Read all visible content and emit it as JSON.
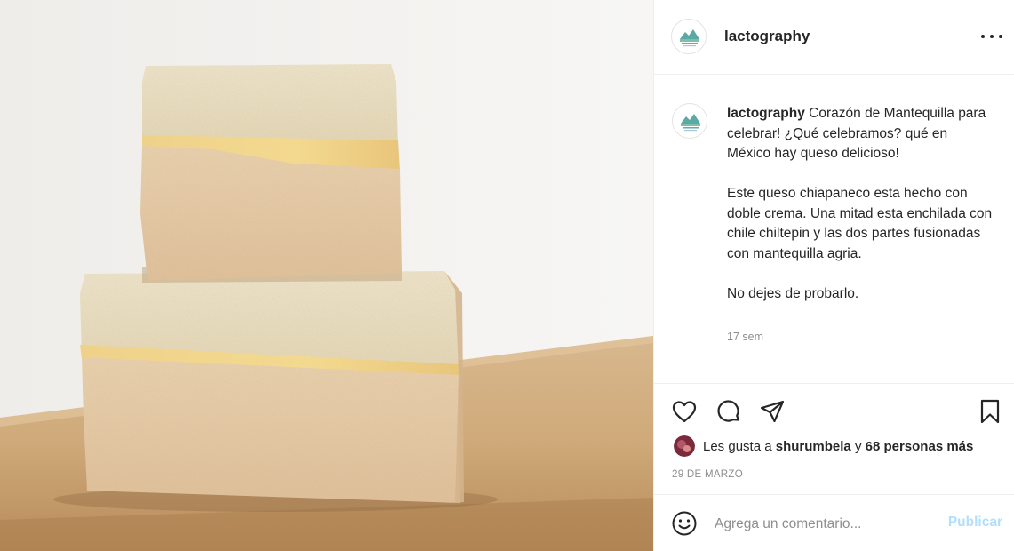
{
  "post": {
    "username": "lactography",
    "more_icon": "more-horizontal-icon",
    "caption": {
      "username": "lactography",
      "line1": "Corazón de Mantequilla para celebrar! ¿Qué celebramos? qué en México hay queso delicioso!",
      "line2": "Este queso chiapaneco esta hecho con doble crema. Una mitad esta enchilada con chile chiltepin y las dos partes fusionadas con mantequilla agria.",
      "line3": "No dejes de probarlo.",
      "time": "17 sem"
    },
    "actions": {
      "like_icon": "heart-icon",
      "comment_icon": "comment-icon",
      "share_icon": "paper-plane-icon",
      "save_icon": "bookmark-icon"
    },
    "likes": {
      "prefix": "Les gusta a",
      "user": "shurumbela",
      "connector": "y",
      "others": "68 personas más"
    },
    "date": "29 DE MARZO",
    "comment": {
      "emoji_icon": "smiley-icon",
      "placeholder": "Agrega un comentario...",
      "publish_label": "Publicar"
    }
  },
  "colors": {
    "text": "#262626",
    "secondary_text": "#8e8e8e",
    "divider": "#efefef",
    "publish_disabled": "#b2dffc"
  }
}
